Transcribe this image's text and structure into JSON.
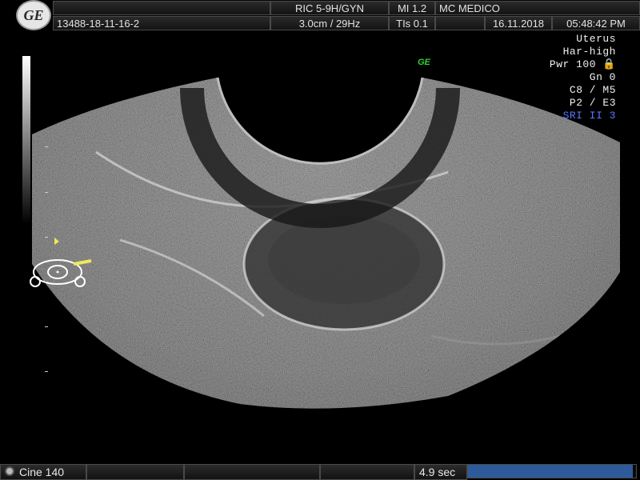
{
  "header": {
    "logo_text": "GE",
    "patient_id": "13488-18-11-16-2",
    "probe": "RIC 5-9H/GYN",
    "depth_freq": "3.0cm / 29Hz",
    "mi": "MI  1.2",
    "tis": "TIs  0.1",
    "institution": "MC MEDICO",
    "date": "16.11.2018",
    "time": "05:48:42 PM"
  },
  "params": {
    "preset": "Uterus",
    "harmonic": "Har-high",
    "power": "Pwr 100",
    "gain": "Gn   0",
    "cm": "C8 / M5",
    "pe": "P2 / E3",
    "sri": "SRI II 3",
    "sri_color": "#5a78ff"
  },
  "overlay": {
    "ge_badge": "GE",
    "ge_badge_color": "#2ed12e"
  },
  "footer": {
    "cine": "Cine 140",
    "duration": "4.9 sec",
    "progress_fraction": 0.98,
    "progress_color": "#2f5a9a"
  }
}
